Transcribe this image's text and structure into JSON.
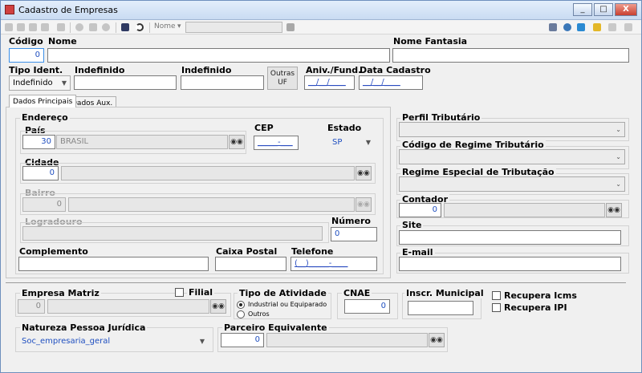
{
  "window": {
    "title": "Cadastro de Empresas",
    "minimize": "_",
    "maximize": "□",
    "close": "X"
  },
  "toolbar": {
    "name_label": "Nome",
    "name_arrow": "▾"
  },
  "header": {
    "codigo_label": "Código",
    "codigo_value": "0",
    "nome_label": "Nome",
    "nome_value": "",
    "nome_fantasia_label": "Nome Fantasia",
    "nome_fantasia_value": "",
    "tipo_ident_label": "Tipo Ident.",
    "tipo_ident_value": "Indefinido",
    "indef1_label": "Indefinido",
    "indef2_label": "Indefinido",
    "outras_uf_line1": "Outras",
    "outras_uf_line2": "UF",
    "aniv_label": "Aniv./Fund.",
    "aniv_value": "__/__/____",
    "data_cadastro_label": "Data Cadastro",
    "data_cadastro_value": "__/__/____"
  },
  "tabs": [
    {
      "label": "Dados Principais"
    },
    {
      "label": "Dados Aux."
    }
  ],
  "endereco": {
    "title": "Endereço",
    "pais_label": "País",
    "pais_code": "30",
    "pais_name": "BRASIL",
    "cep_label": "CEP",
    "cep_value": "_____-___",
    "estado_label": "Estado",
    "estado_value": "SP",
    "cidade_label": "Cidade",
    "cidade_code": "0",
    "bairro_label": "Bairro",
    "bairro_code": "0",
    "logradouro_label": "Logradouro",
    "numero_label": "Número",
    "numero_value": "0",
    "complemento_label": "Complemento",
    "caixa_postal_label": "Caixa Postal",
    "telefone_label": "Telefone",
    "telefone_value": "(__)_____-____"
  },
  "right_panel": {
    "perfil_label": "Perfil Tributário",
    "regime_label": "Código de Regime Tributário",
    "regime_especial_label": "Regime Especial de Tributação",
    "contador_label": "Contador",
    "contador_code": "0",
    "site_label": "Site",
    "email_label": "E-mail"
  },
  "bottom": {
    "empresa_matriz_label": "Empresa Matriz",
    "empresa_matriz_code": "0",
    "filial_label": "Filial",
    "tipo_atividade_label": "Tipo de Atividade",
    "atividade_opt1": "Industrial ou Equiparado",
    "atividade_opt2": "Outros",
    "cnae_label": "CNAE",
    "cnae_value": "0",
    "inscr_municipal_label": "Inscr. Municipal",
    "recupera_icms_label": "Recupera Icms",
    "recupera_ipi_label": "Recupera IPI",
    "natureza_label": "Natureza Pessoa Jurídica",
    "natureza_value": "Soc_empresaria_geral",
    "parceiro_label": "Parceiro Equivalente",
    "parceiro_code": "0"
  },
  "icons": {
    "search": "binoculars-icon",
    "dropdown": "chevron-down-icon"
  }
}
